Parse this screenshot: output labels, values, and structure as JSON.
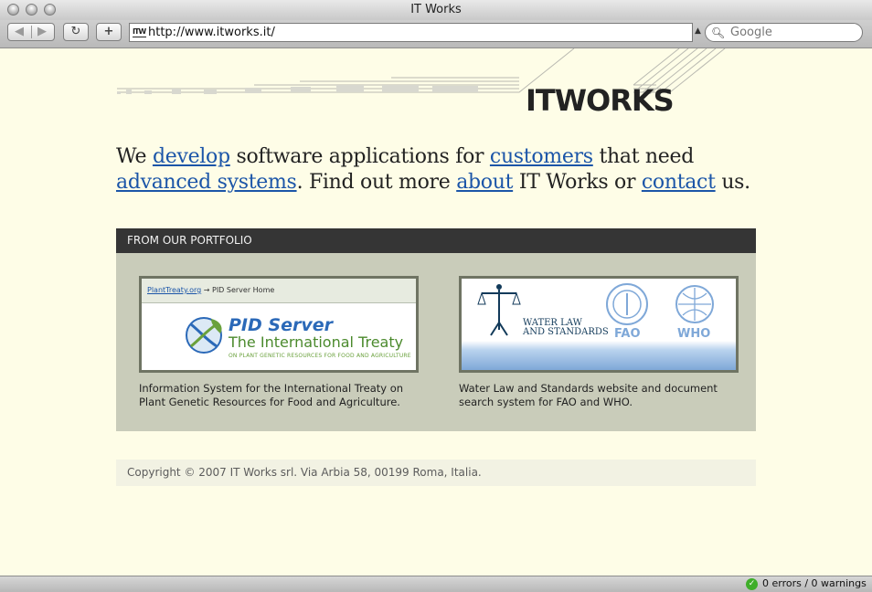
{
  "window": {
    "title": "IT Works"
  },
  "toolbar": {
    "back_icon": "back-arrow-icon",
    "forward_icon": "forward-arrow-icon",
    "reload_label": "↻",
    "new_tab_label": "+",
    "address": "http://www.itworks.it/",
    "favicon_text": "ITW",
    "search_placeholder": "Google"
  },
  "site": {
    "logo": "ITWORKS",
    "intro": {
      "t1": "We ",
      "l1": "develop",
      "t2": " software applications for ",
      "l2": "customers",
      "t3": " that need ",
      "l3": "advanced systems",
      "t4": ". Find out more ",
      "l4": "about",
      "t5": " IT Works or ",
      "l5": "contact",
      "t6": " us."
    },
    "portfolio": {
      "heading": "FROM OUR PORTFOLIO",
      "items": [
        {
          "thumb_link": "PlantTreaty.org",
          "thumb_crumb": " → PID Server Home",
          "thumb_title": "PID Server",
          "thumb_subtitle": "The International Treaty",
          "thumb_note": "ON PLANT GENETIC RESOURCES FOR FOOD AND AGRICULTURE",
          "description": "Information System for the International Treaty on Plant Genetic Resources for Food and Agriculture."
        },
        {
          "thumb_line1": "WATER LAW",
          "thumb_line2": "AND STANDARDS",
          "thumb_fao": "FAO",
          "thumb_who": "WHO",
          "description": "Water Law and Standards website and document search system for FAO and WHO."
        }
      ]
    },
    "footer": "Copyright © 2007 IT Works srl. Via Arbia 58, 00199 Roma, Italia."
  },
  "statusbar": {
    "text": "0 errors / 0 warnings"
  },
  "colors": {
    "page_bg": "#fefde7",
    "link": "#1b55a8",
    "portfolio_bg": "#c9ccba",
    "portfolio_header": "#353535"
  }
}
